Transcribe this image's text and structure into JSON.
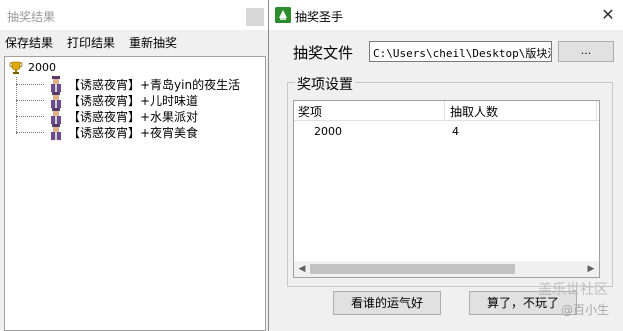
{
  "left_window": {
    "title": "抽奖结果",
    "menu": [
      "保存结果",
      "打印结果",
      "重新抽奖"
    ],
    "tree": {
      "root_label": "2000",
      "children": [
        "【诱惑夜宵】+青岛yin的夜生活",
        "【诱惑夜宵】+儿时味道",
        "【诱惑夜宵】+水果派对",
        "【诱惑夜宵】+夜宵美食"
      ]
    }
  },
  "right_window": {
    "title": "抽奖圣手",
    "close_glyph": "✕",
    "file_label": "抽奖文件",
    "file_path": "C:\\Users\\cheil\\Desktop\\版块活",
    "browse_label": "...",
    "group_title": "奖项设置",
    "columns": [
      "奖项",
      "抽取人数"
    ],
    "rows": [
      {
        "prize": "2000",
        "count": "4"
      }
    ],
    "buttons": {
      "lucky": "看谁的运气好",
      "quit": "算了，不玩了"
    }
  },
  "watermark": {
    "line1": "盖乐世社区",
    "line2": "@百小生"
  },
  "icons": {
    "root": "trophy-icon",
    "child": "person-icon",
    "app": "app-icon"
  },
  "colors": {
    "window_bg": "#f0f0f0",
    "app_icon": "#2e8b2e",
    "trophy": "#e0a800"
  }
}
